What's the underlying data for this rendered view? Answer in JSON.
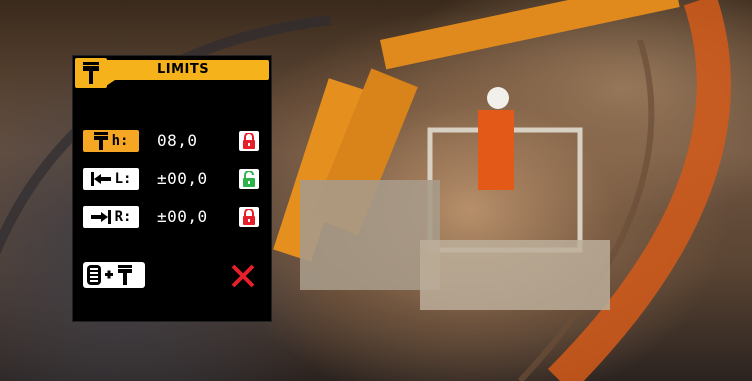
{
  "panel": {
    "title": "LIMITS",
    "header_icon": "boom-height-icon"
  },
  "rows": [
    {
      "key": "h",
      "label": "h:",
      "icon": "height-limit-icon",
      "value": "08,0",
      "locked": true,
      "active": true
    },
    {
      "key": "l",
      "label": "L:",
      "icon": "left-limit-icon",
      "value": "±00,0",
      "locked": false,
      "active": false
    },
    {
      "key": "r",
      "label": "R:",
      "icon": "right-limit-icon",
      "value": "±00,0",
      "locked": true,
      "active": false
    }
  ],
  "actions": {
    "function_icon": "tire-plus-boom-icon",
    "cancel_icon": "cancel-x-icon"
  },
  "colors": {
    "accent": "#f5b21a",
    "lock_closed": "#e5202a",
    "lock_open": "#2fb24a",
    "cancel": "#e5202a"
  }
}
